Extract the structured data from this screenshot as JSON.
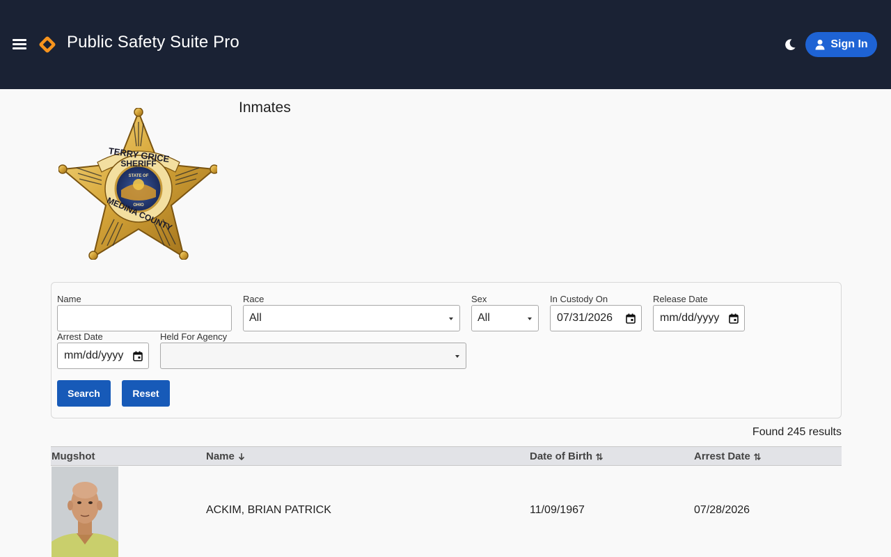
{
  "app": {
    "title": "Public Safety Suite Pro",
    "signin_label": "Sign In",
    "menu_icon": "menu-icon",
    "theme_icon": "moon-icon",
    "brand_color": "#f7941d"
  },
  "badge": {
    "line1": "TERRY GRICE",
    "line2": "SHERIFF",
    "line3": "MEDINA COUNTY",
    "seal_top": "STATE OF",
    "seal_bottom": "OHIO"
  },
  "page": {
    "heading": "Inmates"
  },
  "filters": {
    "name_label": "Name",
    "name_value": "",
    "race_label": "Race",
    "race_value": "All",
    "sex_label": "Sex",
    "sex_value": "All",
    "custody_label": "In Custody On",
    "custody_value": "07/31/2026",
    "release_label": "Release Date",
    "release_value": "mm/dd/yyyy",
    "arrest_label": "Arrest Date",
    "arrest_value": "mm/dd/yyyy",
    "agency_label": "Held For Agency",
    "agency_value": "",
    "search_label": "Search",
    "reset_label": "Reset"
  },
  "results": {
    "count_text": "Found 245 results"
  },
  "table": {
    "columns": {
      "mugshot": "Mugshot",
      "name": "Name",
      "dob": "Date of Birth",
      "arrest": "Arrest Date"
    },
    "rows": [
      {
        "name": "ACKIM, BRIAN PATRICK",
        "dob": "11/09/1967",
        "arrest_date": "07/28/2026"
      }
    ]
  }
}
